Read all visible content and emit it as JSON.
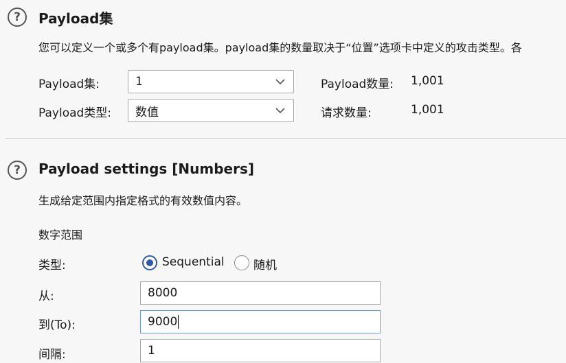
{
  "payload_sets": {
    "title": "Payload集",
    "description": "您可以定义一个或多个有payload集。payload集的数量取决于“位置”选项卡中定义的攻击类型。各",
    "set_label": "Payload集:",
    "set_value": "1",
    "type_label": "Payload类型:",
    "type_value": "数值",
    "count_label": "Payload数量:",
    "count_value": "1,001",
    "request_label": "请求数量:",
    "request_value": "1,001"
  },
  "payload_settings": {
    "title": "Payload settings [Numbers]",
    "description": "生成给定范围内指定格式的有效数值内容。",
    "range_heading": "数字范围",
    "type_label": "类型:",
    "sequential_label": "Sequential",
    "random_label": "随机",
    "selected": "sequential",
    "from_label": "从:",
    "from_value": "8000",
    "to_label": "到(To):",
    "to_value": "9000",
    "step_label": "间隔:",
    "step_value": "1"
  },
  "icons": {
    "help": "help-circle-icon",
    "dropdown": "chevron-down-icon"
  },
  "colors": {
    "accent": "#2e5aa8",
    "focus_border": "#6a9bd8",
    "background": "#f7f7f7"
  }
}
